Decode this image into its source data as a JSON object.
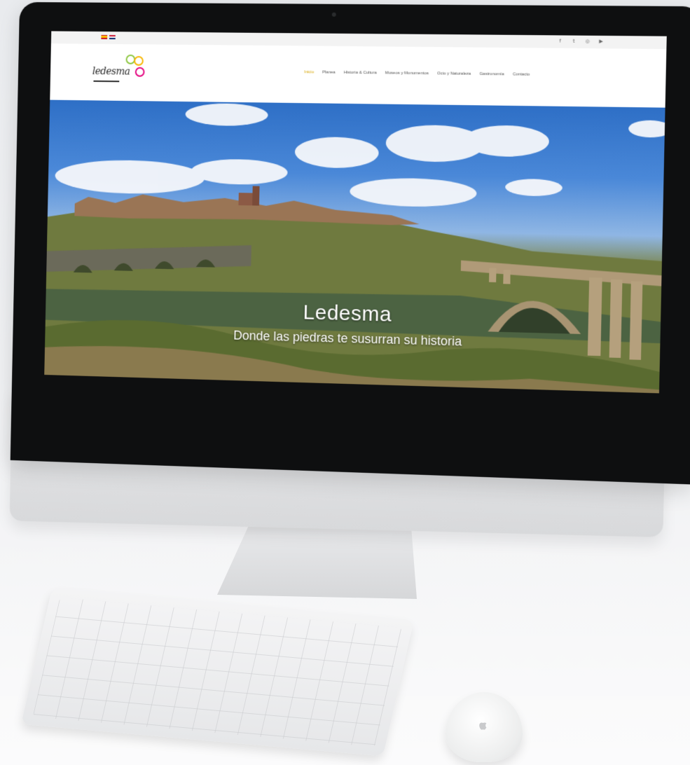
{
  "site": {
    "logo_text": "ledesma",
    "flags": [
      "es",
      "en"
    ],
    "social_icons": [
      "facebook-icon",
      "twitter-icon",
      "instagram-icon",
      "youtube-icon"
    ],
    "nav": {
      "items": [
        {
          "label": "Inicio",
          "active": true
        },
        {
          "label": "Planea",
          "active": false
        },
        {
          "label": "Historia & Cultura",
          "active": false
        },
        {
          "label": "Museos y Monumentos",
          "active": false
        },
        {
          "label": "Ocio y Naturaleza",
          "active": false
        },
        {
          "label": "Gastronomía",
          "active": false
        },
        {
          "label": "Contacto",
          "active": false
        }
      ]
    },
    "hero": {
      "title": "Ledesma",
      "subtitle": "Donde las piedras te susurran su historia"
    }
  },
  "colors": {
    "nav_active": "#d6a400",
    "nav_text": "#555555",
    "hero_text": "#ffffff",
    "imac_bezel": "#0e0f10",
    "imac_aluminium": "#d9dadc"
  }
}
